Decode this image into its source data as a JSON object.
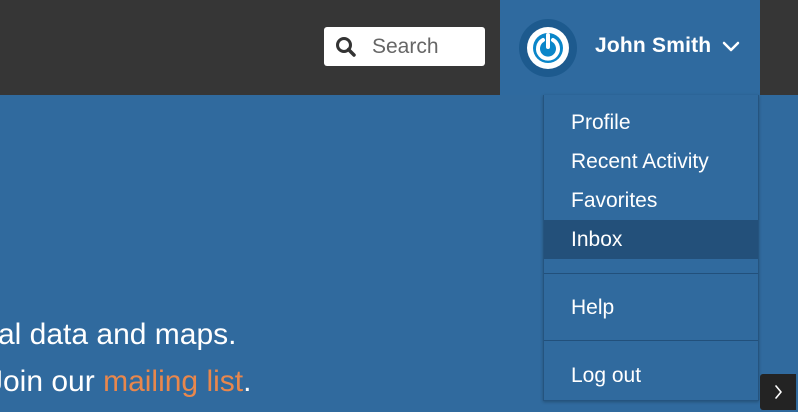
{
  "header": {
    "search": {
      "placeholder": "Search",
      "value": "",
      "icon": "search-icon"
    },
    "user": {
      "name": "John Smith",
      "avatar_icon": "power-icon",
      "menu_icon": "chevron-down-icon"
    }
  },
  "hero": {
    "line1": "al data and maps.",
    "line2_prefix": "Join our ",
    "line2_link": "mailing list",
    "line2_suffix": "."
  },
  "user_menu": {
    "items": [
      {
        "label": "Profile"
      },
      {
        "label": "Recent Activity"
      },
      {
        "label": "Favorites"
      },
      {
        "label": "Inbox",
        "active": true
      },
      {
        "label": "Help"
      },
      {
        "label": "Log out"
      }
    ]
  },
  "controls": {
    "next_icon": "chevron-right-icon"
  },
  "colors": {
    "topbar": "#363636",
    "brand_blue": "#306a9e",
    "active_item": "#23507a",
    "link_accent": "#e9874c"
  }
}
